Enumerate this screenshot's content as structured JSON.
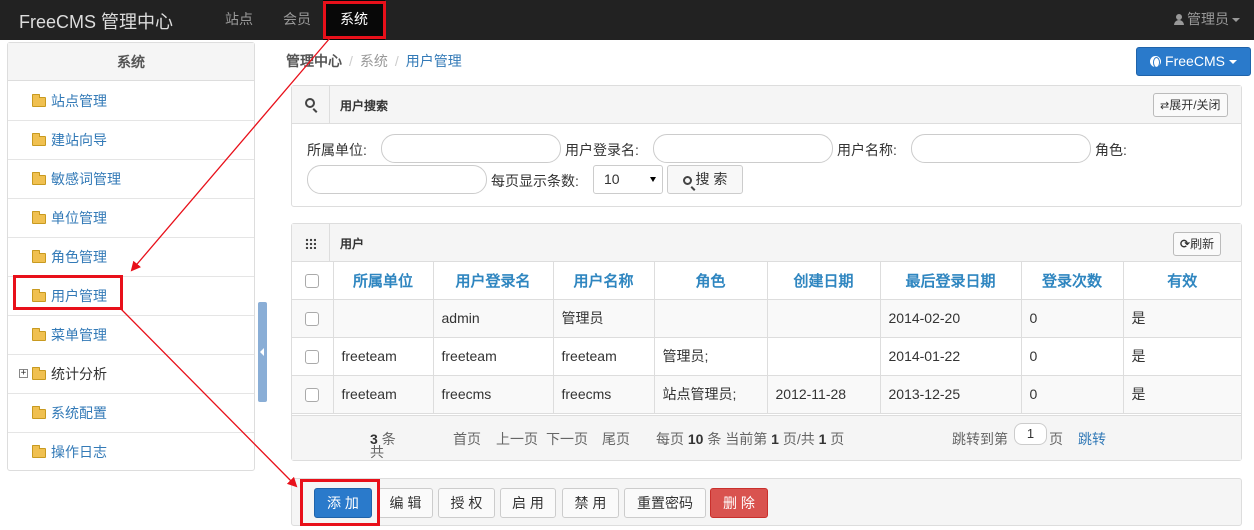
{
  "navbar": {
    "brand": "FreeCMS 管理中心",
    "items": [
      {
        "label": "站点"
      },
      {
        "label": "会员"
      },
      {
        "label": "系统"
      }
    ],
    "user": "管理员"
  },
  "sidebar": {
    "title": "系统",
    "items": [
      {
        "label": "站点管理"
      },
      {
        "label": "建站向导"
      },
      {
        "label": "敏感词管理"
      },
      {
        "label": "单位管理"
      },
      {
        "label": "角色管理"
      },
      {
        "label": "用户管理"
      },
      {
        "label": "菜单管理"
      },
      {
        "label": "统计分析"
      },
      {
        "label": "系统配置"
      },
      {
        "label": "操作日志"
      }
    ],
    "expander": "+"
  },
  "breadcrumb": {
    "home": "管理中心",
    "section": "系统",
    "current": "用户管理",
    "sep": "/"
  },
  "freecms_button": "FreeCMS",
  "search": {
    "title": "用户搜索",
    "toggle_label": "展开/关闭",
    "unit_label": "所属单位:",
    "login_label": "用户登录名:",
    "name_label": "用户名称:",
    "role_label": "角色:",
    "pagesize_label": "每页显示条数:",
    "pagesize_value": "10",
    "search_button": "搜 索"
  },
  "table": {
    "title": "用户",
    "refresh_label": "刷新",
    "columns": [
      "所属单位",
      "用户登录名",
      "用户名称",
      "角色",
      "创建日期",
      "最后登录日期",
      "登录次数",
      "有效"
    ],
    "rows": [
      [
        "",
        "admin",
        "管理员",
        "",
        "",
        "2014-02-20",
        "0",
        "是"
      ],
      [
        "freeteam",
        "freeteam",
        "freeteam",
        "管理员;",
        "",
        "2014-01-22",
        "0",
        "是"
      ],
      [
        "freeteam",
        "freecms",
        "freecms",
        "站点管理员;",
        "2012-11-28",
        "2013-12-25",
        "0",
        "是"
      ]
    ]
  },
  "pager": {
    "total_prefix": "共",
    "total": "3",
    "total_suffix": "条",
    "first": "首页",
    "prev": "上一页",
    "next": "下一页",
    "last": "尾页",
    "per_prefix": "每页",
    "per": "10",
    "per_mid": "条 当前第",
    "current": "1",
    "page_of": "页/共",
    "pages": "1",
    "page_suffix": "页",
    "jump_to": "跳转到第",
    "jump_value": "1",
    "jump_suffix": "页",
    "jump_button": "跳转"
  },
  "actions": [
    {
      "label": "添 加"
    },
    {
      "label": "编 辑"
    },
    {
      "label": "授 权"
    },
    {
      "label": "启 用"
    },
    {
      "label": "禁 用"
    },
    {
      "label": "重置密码"
    },
    {
      "label": "删 除"
    }
  ],
  "colors": {
    "accent": "#2a7acb",
    "link": "#337ab7",
    "annotation": "#e8101a",
    "danger": "#d9534f"
  }
}
